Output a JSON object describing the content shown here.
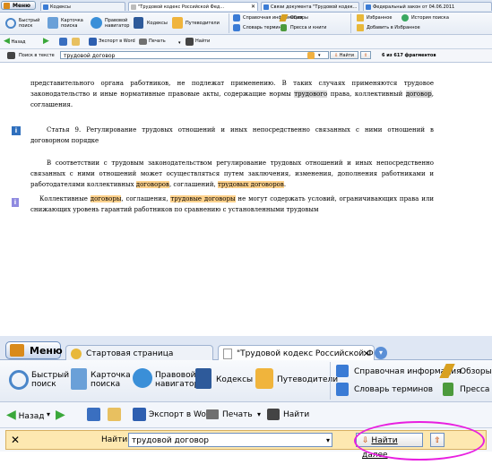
{
  "top": {
    "menu_label": "Меню",
    "tabs": [
      "Кодексы",
      "\"Трудовой кодекс Российской Фед...",
      "Связи документа \"Трудовой кодек...",
      "Федеральный закон от 04.06.2011"
    ],
    "toolbar": {
      "quick_search": "Быстрый\nпоиск",
      "card_search": "Карточка\nпоиска",
      "legal_nav": "Правовой\nнавигатор",
      "codes": "Кодексы",
      "guides": "Путеводители",
      "reference": "Справочная информация",
      "reviews": "Обзоры",
      "dictionary": "Словарь терминов",
      "press": "Пресса и книги",
      "favorites": "Избранное",
      "history": "История поиска",
      "add_favorites": "Добавить в Избранное"
    },
    "toolbar2": {
      "back": "Назад",
      "export_word": "Экспорт в Word",
      "print": "Печать",
      "find": "Найти"
    },
    "search": {
      "label": "Поиск в тексте",
      "value": "трудовой договор",
      "find_button": "Найти",
      "count": "6 из 617 фрагментов"
    },
    "document": {
      "para1": "представительного органа работников, не подлежат применению. В таких случаях применяются трудовое законодательство и иные нормативные правовые акты, содержащие нормы трудового права, коллективный договор, соглашения.",
      "article9": "Статья 9. Регулирование трудовых отношений и иных непосредственно связанных с ними отношений в договорном порядке",
      "para2": "В соответствии с трудовым законодательством регулирование трудовых отношений и иных непосредственно связанных с ними отношений может осуществляться путем заключения, изменения, дополнения работниками и работодателями коллективных договоров, соглашений, трудовых договоров.",
      "para3": "Коллективные договоры, соглашения, трудовые договоры не могут содержать условий, ограничивающих права или снижающих уровень гарантий работников по сравнению с установленными трудовым"
    }
  },
  "bottom": {
    "menu_label": "Меню",
    "tabs": [
      "Стартовая страница",
      "\"Трудовой кодекс Российской Феде..."
    ],
    "toolbar": {
      "quick_search": "Быстрый\nпоиск",
      "card_search": "Карточка\nпоиска",
      "legal_nav": "Правовой\nнавигатор",
      "codes": "Кодексы",
      "guides": "Путеводители",
      "reference": "Справочная информация",
      "reviews": "Обзоры",
      "dictionary": "Словарь терминов",
      "press": "Пресса и к"
    },
    "toolbar2": {
      "back": "Назад",
      "export_word": "Экспорт в Word",
      "print": "Печать",
      "find": "Найти"
    },
    "search": {
      "label": "Найти",
      "value": "трудовой договор",
      "find_next": "Найти далее"
    }
  },
  "colors": {
    "accent": "#2f6fbd",
    "highlight_gray": "#d9d9d9",
    "highlight_orange": "#ffd28c",
    "annotation_circle": "#e81fe0"
  }
}
